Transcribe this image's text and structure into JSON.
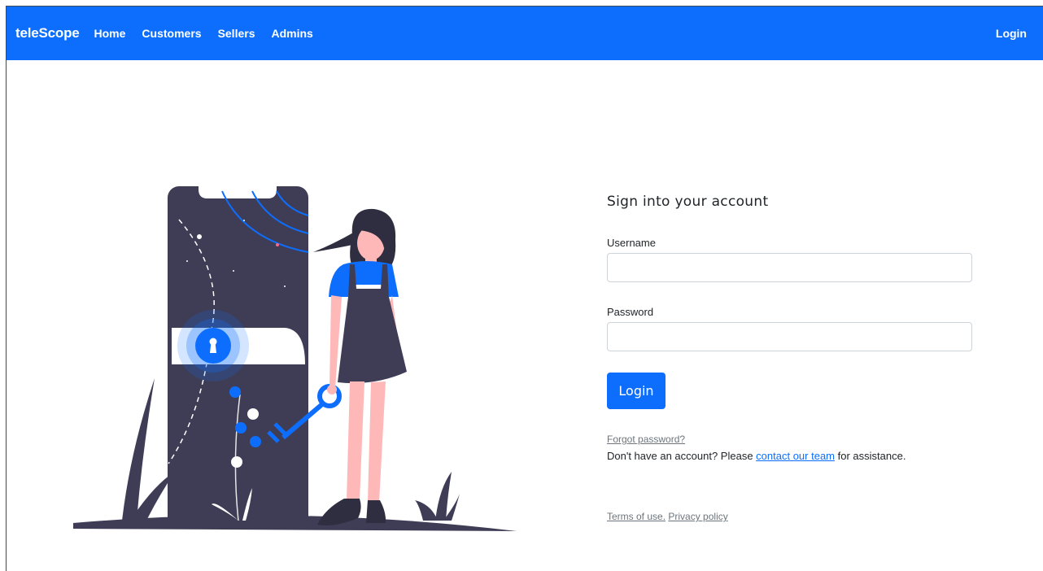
{
  "navbar": {
    "brand": "teleScope",
    "links": [
      "Home",
      "Customers",
      "Sellers",
      "Admins"
    ],
    "login": "Login"
  },
  "form": {
    "title": "Sign into your account",
    "username_label": "Username",
    "password_label": "Password",
    "submit_label": "Login",
    "forgot": "Forgot password?",
    "help_prefix": "Don't have an account? Please ",
    "help_link": "contact our team",
    "help_suffix": " for assistance."
  },
  "footer": {
    "terms": "Terms of use.",
    "privacy": "Privacy policy"
  },
  "colors": {
    "primary": "#0d6efd",
    "dark": "#3f3d56",
    "skin": "#ffb8b8",
    "hair": "#2f2e41"
  },
  "icons": [
    "keyhole-icon",
    "key-icon"
  ]
}
